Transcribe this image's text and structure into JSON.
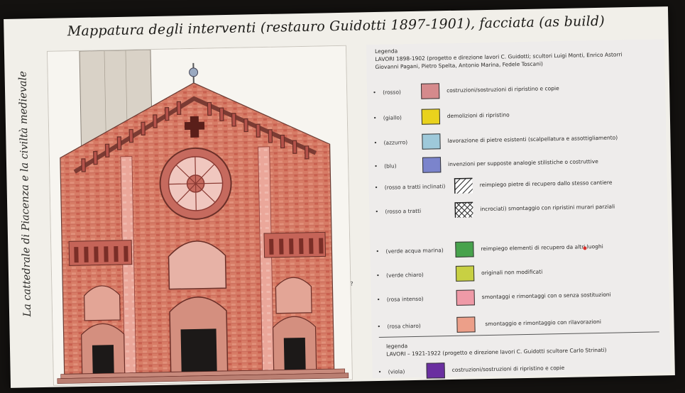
{
  "title": "Mappatura degli interventi (restauro Guidotti 1897-1901), facciata (as build)",
  "side_caption": "La cattedrale di Piacenza e la civiltà medievale",
  "drawing_mark": "?",
  "legend": {
    "heading": "Legenda",
    "works": "LAVORI 1898-1902 (progetto e direzione lavori C. Guidotti; scultori Luigi Monti, Enrico Astorri",
    "works_cont": "Giovanni Pagani, Pietro Spelta, Antonio Marina, Fedele Toscani)",
    "items": [
      {
        "label": "(rosso)",
        "color": "#d58a8c",
        "desc": "costruzioni/sostruzioni di ripristino e copie"
      },
      {
        "label": "(giallo)",
        "color": "#e9d21d",
        "desc": "demolizioni di ripristino"
      },
      {
        "label": "(azzurro)",
        "color": "#9ec9da",
        "desc": "lavorazione di pietre esistenti (scalpellatura e assottigliamento)"
      },
      {
        "label": "(blu)",
        "color": "#7b84cc",
        "desc": "invenzioni per supposte analogie stilistiche o costruttive"
      },
      {
        "label": "(rosso a tratti inclinati)",
        "color": "#ffffff",
        "desc": "reimpiego pietre di recupero dallo stesso cantiere"
      },
      {
        "label": "(rosso a tratti",
        "color": "#ffffff",
        "desc": "incrociati) smontaggio con ripristini murari parziali"
      },
      {
        "label": "(verde acqua marina)",
        "color": "#47a24c",
        "desc": "reimpiego elementi di recupero da altri luoghi"
      },
      {
        "label": "(verde chiaro)",
        "color": "#c8d043",
        "desc": "originali non modificati"
      },
      {
        "label": "(rosa intenso)",
        "color": "#ef9aa7",
        "desc": "smontaggi e rimontaggi con o senza sostituzioni"
      },
      {
        "label": "(rosa chiaro)",
        "color": "#ec9f89",
        "desc": "smontaggio e rimontaggio con rilavorazioni"
      }
    ],
    "legend2_heading": "legenda",
    "works2": "LAVORI – 1921-1922 (progetto e direzione lavori C. Guidotti scultore Carlo Strinati)",
    "items2": [
      {
        "label": "(viola)",
        "color": "#6a2fa0",
        "desc": "costruzioni/sostruzioni di ripristino e copie"
      }
    ]
  }
}
